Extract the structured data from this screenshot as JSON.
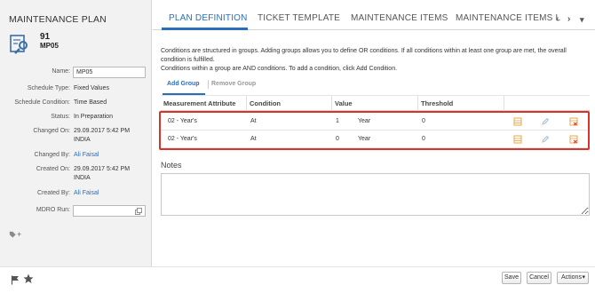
{
  "left": {
    "title": "MAINTENANCE PLAN",
    "number": "91",
    "code": "MP05",
    "fields": {
      "name_label": "Name:",
      "name_value": "MP05",
      "schedule_type_label": "Schedule Type:",
      "schedule_type_value": "Fixed Values",
      "schedule_condition_label": "Schedule Condition:",
      "schedule_condition_value": "Time Based",
      "status_label": "Status:",
      "status_value": "In Preparation",
      "changed_on_label": "Changed On:",
      "changed_on_value": "29.09.2017 5:42 PM",
      "changed_on_tz": "INDIA",
      "changed_by_label": "Changed By:",
      "changed_by_value": "Ali Faisal",
      "created_on_label": "Created On:",
      "created_on_value": "29.09.2017 5:42 PM",
      "created_on_tz": "INDIA",
      "created_by_label": "Created By:",
      "created_by_value": "Ali Faisal",
      "mdro_label": "MDRO Run:",
      "mdro_value": ""
    },
    "tag_icon": "tag-add-icon",
    "tag_plus": "+"
  },
  "tabs": [
    {
      "label": "PLAN DEFINITION",
      "active": true
    },
    {
      "label": "TICKET TEMPLATE",
      "active": false
    },
    {
      "label": "MAINTENANCE ITEMS",
      "active": false
    },
    {
      "label": "MAINTENANCE ITEMS L",
      "active": false
    }
  ],
  "tab_nav": {
    "prev": "‹",
    "next": "›"
  },
  "description": {
    "line1": "Conditions are structured in groups. Adding groups allows you to define OR conditions. If all conditions within at least one group are met, the overall condition is fulfilled.",
    "line2": "Conditions within a group are AND conditions. To add a condition, click Add Condition."
  },
  "group_actions": {
    "add": "Add Group",
    "remove": "Remove Group"
  },
  "table": {
    "headers": [
      "Measurement Attribute",
      "Condition",
      "Value",
      "Threshold"
    ],
    "rows": [
      {
        "attribute": "02 - Year's",
        "condition": "At",
        "value": "1",
        "unit": "Year",
        "threshold": "0"
      },
      {
        "attribute": "02 - Year's",
        "condition": "At",
        "value": "0",
        "unit": "Year",
        "threshold": "0"
      }
    ],
    "row_icons": [
      "list-icon",
      "edit-pencil-icon",
      "delete-row-icon"
    ]
  },
  "notes": {
    "label": "Notes",
    "value": ""
  },
  "footer": {
    "icons": [
      "flag-icon",
      "star-icon"
    ],
    "save": "Save",
    "cancel": "Cancel",
    "actions": "Actions",
    "actions_arrow": "▾"
  },
  "colors": {
    "accent": "#2a6ebb",
    "highlight": "#d9342b",
    "panel_bg": "#f2f2f2",
    "icon_orange": "#e8a13a"
  }
}
